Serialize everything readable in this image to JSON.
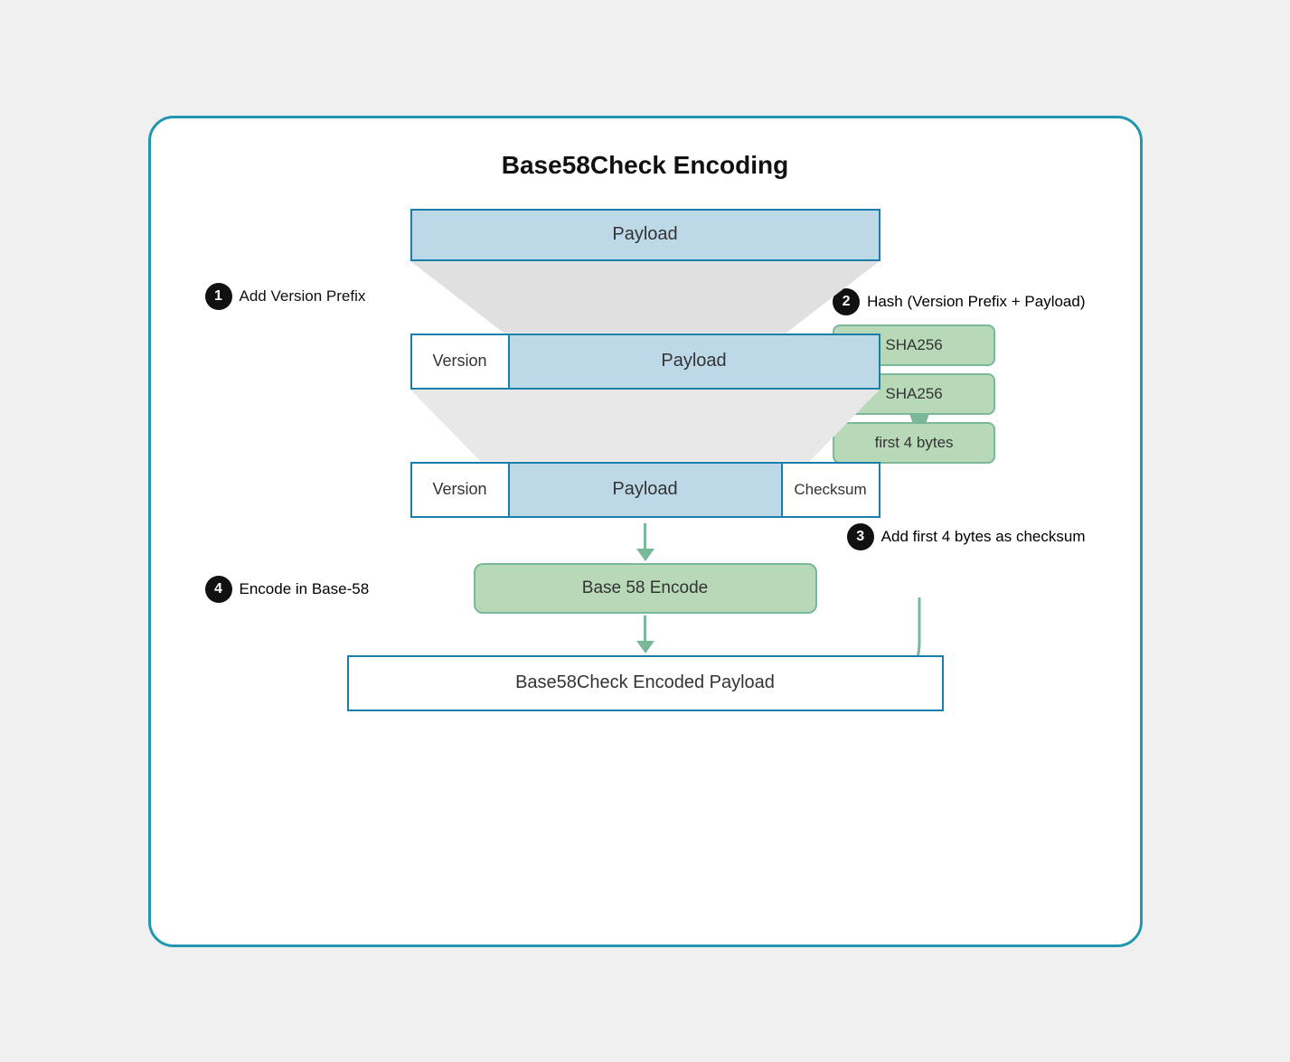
{
  "title": "Base58Check Encoding",
  "steps": [
    {
      "number": "1",
      "label": "Add Version Prefix"
    },
    {
      "number": "2",
      "label": "Hash (Version Prefix + Payload)"
    },
    {
      "number": "3",
      "label": "Add first 4 bytes as checksum"
    },
    {
      "number": "4",
      "label": "Encode in Base-58"
    }
  ],
  "boxes": {
    "top_payload": "Payload",
    "version": "Version",
    "payload": "Payload",
    "checksum": "Checksum",
    "sha256_1": "SHA256",
    "sha256_2": "SHA256",
    "first4": "first 4 bytes",
    "base58_encode": "Base 58 Encode",
    "final": "Base58Check Encoded Payload"
  },
  "colors": {
    "blue_border": "#1a7fa8",
    "blue_fill": "#bdd9e8",
    "green_fill": "#b8d9b8",
    "green_border": "#7ab89a",
    "outer_border": "#2196b0",
    "funnel_bg": "#e0e0e0"
  }
}
